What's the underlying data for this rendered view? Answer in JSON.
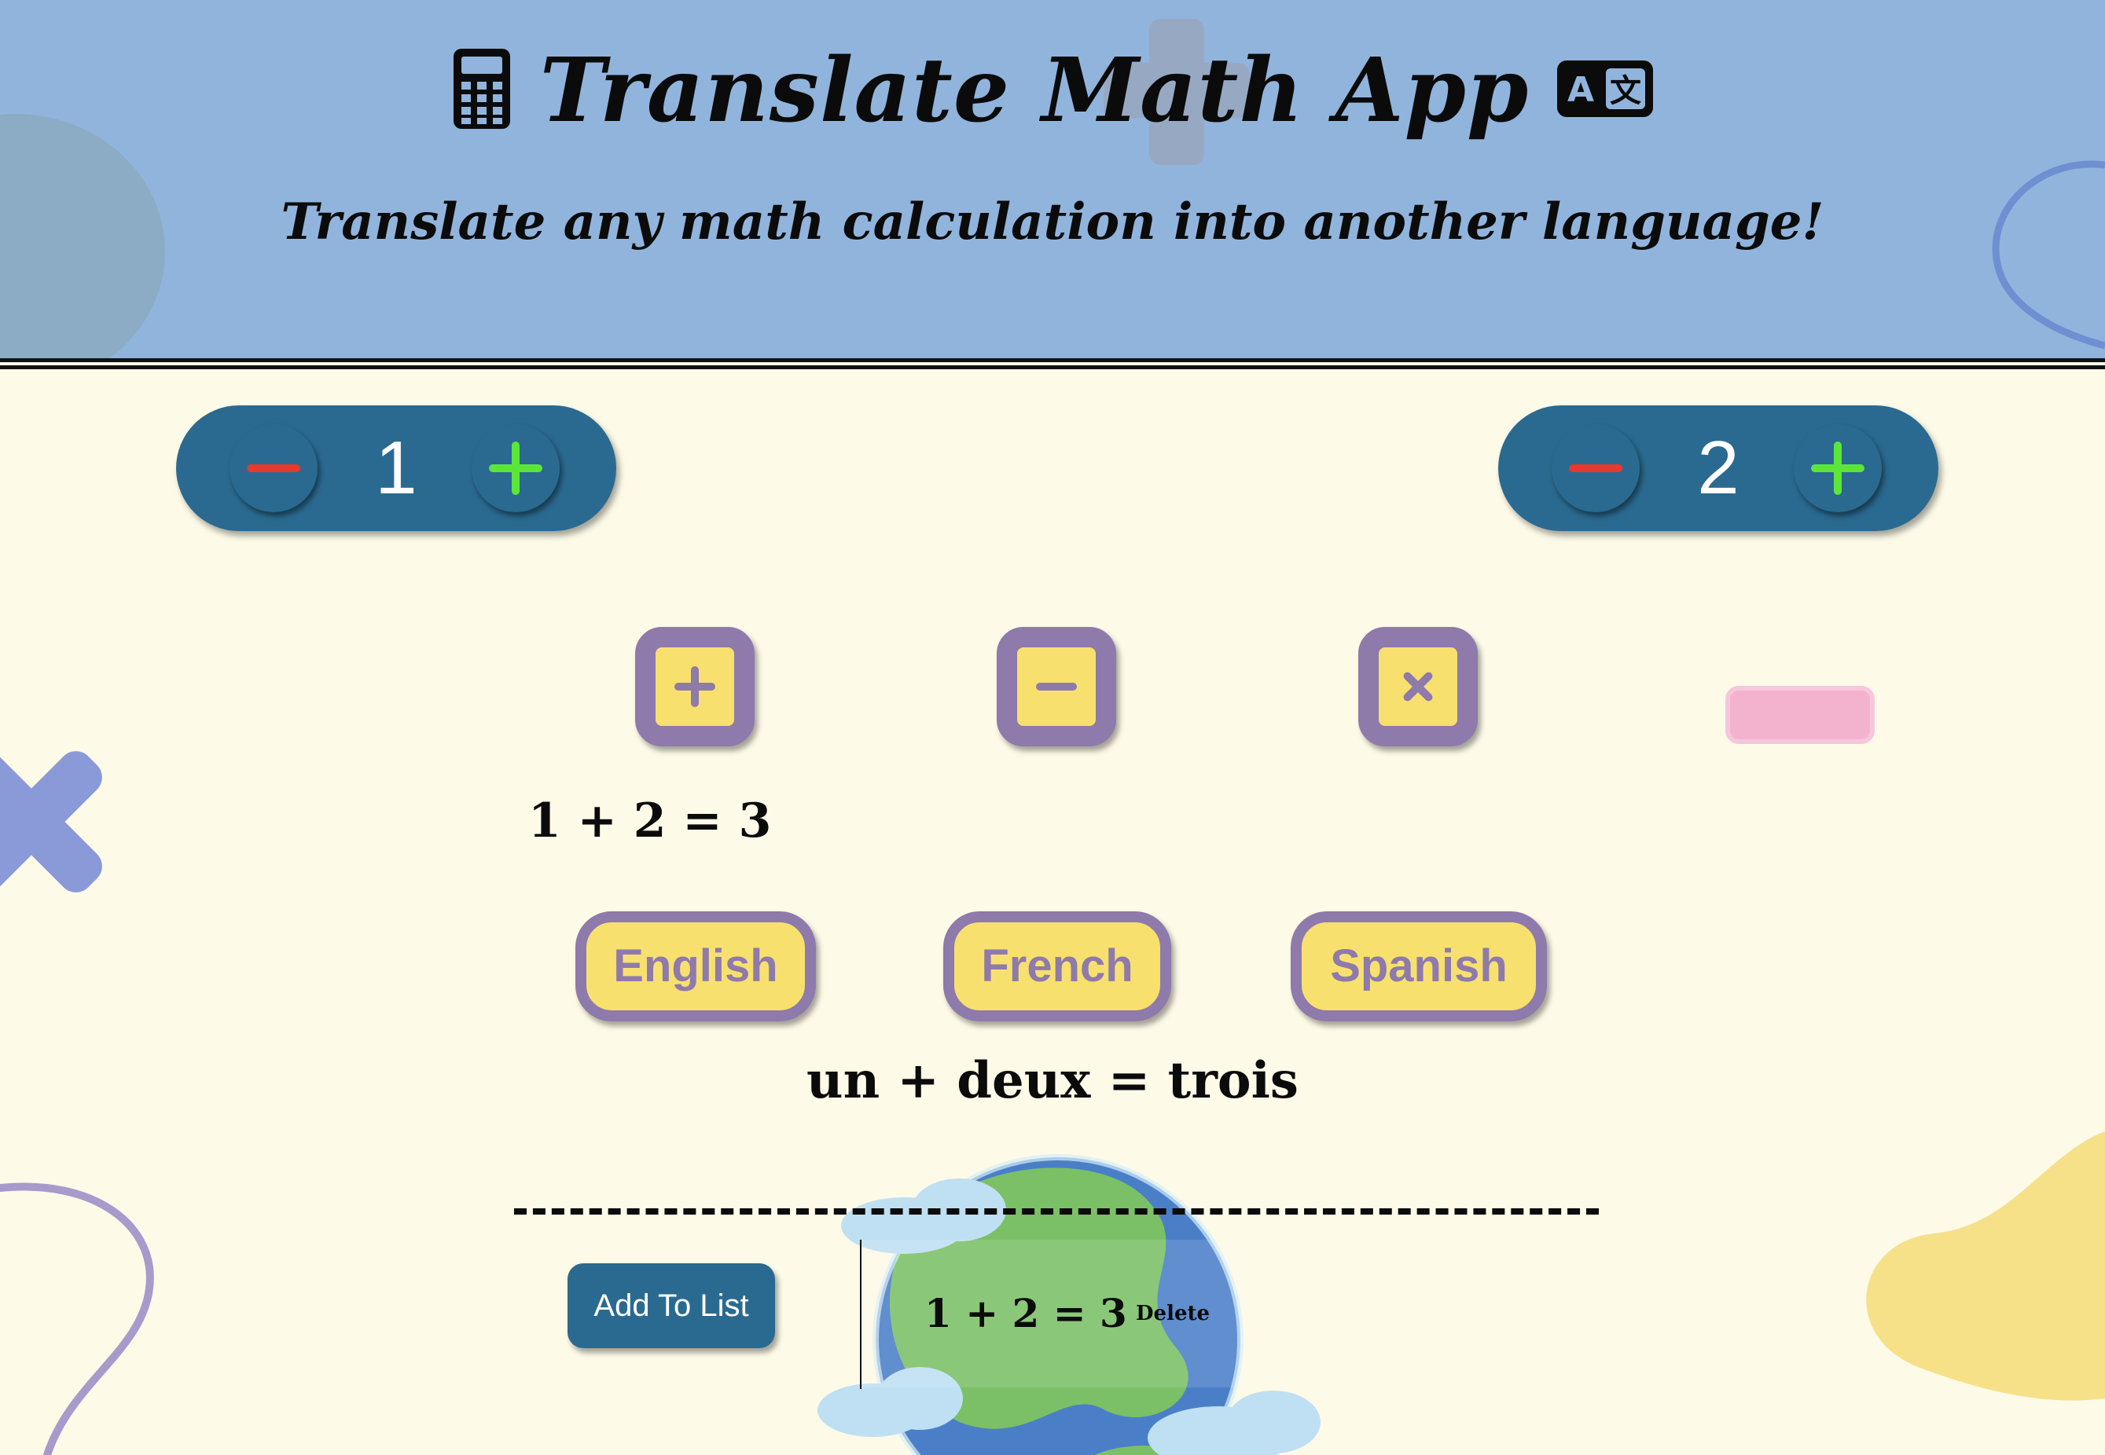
{
  "header": {
    "title": "Translate Math App",
    "subtitle": "Translate any math calculation into another language!",
    "title_left_icon": "calculator-icon",
    "title_right_icon": "translate-icon"
  },
  "stepper_one": {
    "value": "1",
    "decrement_icon": "minus-icon",
    "increment_icon": "plus-icon"
  },
  "stepper_two": {
    "value": "2",
    "decrement_icon": "minus-icon",
    "increment_icon": "plus-icon"
  },
  "operations": [
    "plus-icon",
    "minus-icon",
    "times-icon"
  ],
  "equation": "1 + 2 = 3",
  "languages": {
    "english": "English",
    "french": "French",
    "spanish": "Spanish"
  },
  "translation": "un + deux = trois",
  "list": {
    "add_label": "Add To List",
    "items": [
      {
        "equation": "1 + 2 = 3",
        "delete_label": "Delete"
      }
    ]
  },
  "colors": {
    "header_bg": "#91b4dc",
    "page_bg": "#fdfae8",
    "stepper_bg": "#2a6a90",
    "op_fill": "#f8e06e",
    "op_border": "#8e7aab",
    "minus_red": "#e8392e",
    "plus_green": "#5ce63a"
  }
}
